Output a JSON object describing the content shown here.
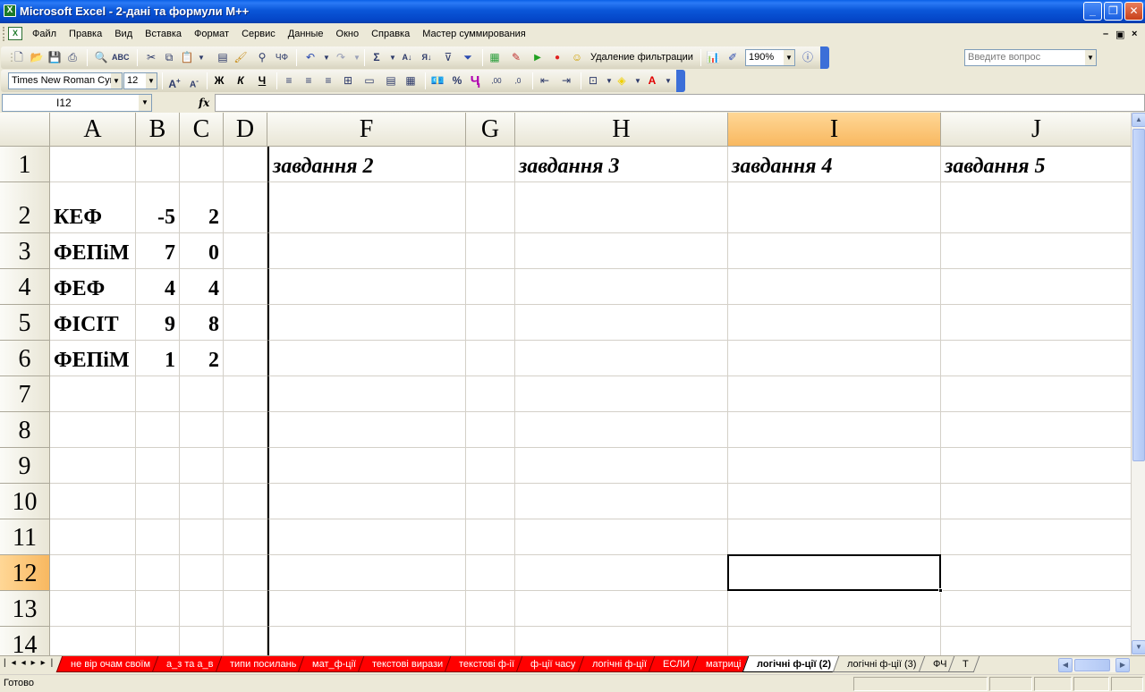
{
  "window": {
    "title": "Microsoft Excel - 2-дані та формули M++",
    "app_icon_glyph": "X"
  },
  "menu": {
    "items": [
      "Файл",
      "Правка",
      "Вид",
      "Вставка",
      "Формат",
      "Сервис",
      "Данные",
      "Окно",
      "Справка",
      "Мастер суммирования"
    ],
    "help_placeholder": "Введите вопрос"
  },
  "toolbar": {
    "remove_filter_label": "Удаление фильтрации",
    "zoom": "190%",
    "font_name": "Times New Roman Cyr",
    "font_size": "12"
  },
  "formula_bar": {
    "name_box": "I12",
    "fx_label": "fx",
    "formula": ""
  },
  "grid": {
    "columns": [
      "A",
      "B",
      "C",
      "D",
      "F",
      "G",
      "H",
      "I",
      "J"
    ],
    "rows": [
      "1",
      "2",
      "3",
      "4",
      "5",
      "6",
      "7",
      "8",
      "9",
      "10",
      "11",
      "12",
      "13",
      "14"
    ],
    "active_cell": "I12",
    "cells": {
      "F1": "завдання 2",
      "H1": "завдання 3",
      "I1": "завдання 4",
      "J1": "завдання 5",
      "A2": "КЕФ",
      "B2": "-5",
      "C2": "2",
      "A3": "ФЕПіМ",
      "B3": "7",
      "C3": "0",
      "A4": "ФЕФ",
      "B4": "4",
      "C4": "4",
      "A5": "ФІСІТ",
      "B5": "9",
      "C5": "8",
      "A6": "ФЕПіМ",
      "B6": "1",
      "C6": "2"
    }
  },
  "sheet_tabs": [
    {
      "label": "не вір очам своїм",
      "color": "#ff0000"
    },
    {
      "label": "а_з та а_в",
      "color": "#ff0000"
    },
    {
      "label": "типи посилань",
      "color": "#ff0000"
    },
    {
      "label": "мат_ф-ції",
      "color": "#ff0000"
    },
    {
      "label": "текстові вирази",
      "color": "#ff0000"
    },
    {
      "label": "текстові ф-ії",
      "color": "#ff0000"
    },
    {
      "label": "ф-ції часу",
      "color": "#ff0000"
    },
    {
      "label": "логічні ф-ції",
      "color": "#ff0000"
    },
    {
      "label": "ЕСЛИ",
      "color": "#ff0000"
    },
    {
      "label": "матриці",
      "color": "#ff0000"
    },
    {
      "label": "логічні ф-ції (2)",
      "color": "#ffffff",
      "active": true
    },
    {
      "label": "логічні ф-ції (3)",
      "color": "#ece9d8"
    },
    {
      "label": "ФЧ",
      "color": "#ece9d8"
    },
    {
      "label": "Т",
      "color": "#ece9d8"
    }
  ],
  "status": {
    "text": "Готово"
  },
  "colors": {
    "active_header": "#f8b860",
    "title_bar": "#0a56d8",
    "sheet_tab_red": "#ff0000"
  }
}
